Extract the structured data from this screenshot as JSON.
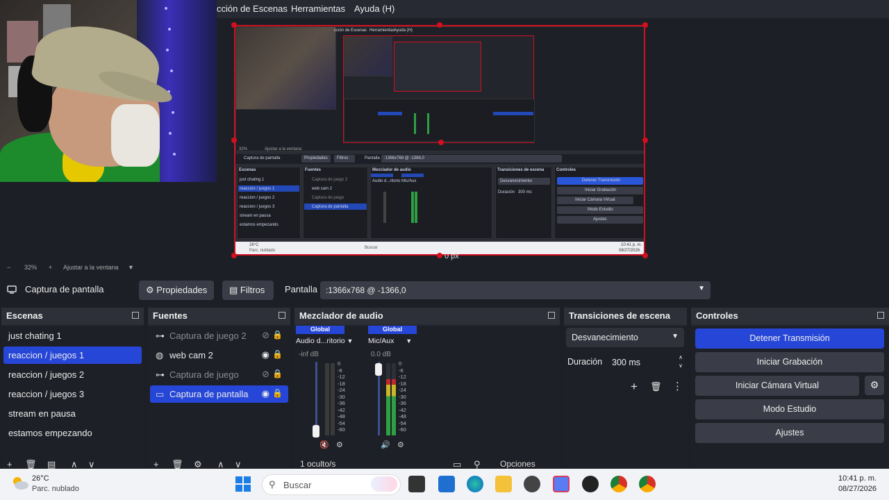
{
  "menubar": {
    "items": [
      "cción de Escenas",
      "Herramientas",
      "Ayuda (H)"
    ]
  },
  "preview": {
    "size_label": "0 px",
    "nested_menu": [
      "cción de Escenas",
      "Herramientas",
      "Ayuda (H)"
    ],
    "nested_source_bar": {
      "source": "Captura de pantalla",
      "props": "Propiedades",
      "filters": "Filtros",
      "display_label": "Pantalla",
      "display_value": ":1366x768 @ -1366,0"
    },
    "nested_zoom": "32%",
    "nested_fit": "Ajustar a la ventana",
    "nested_scenes": [
      "just chating 1",
      "reaccion / juegos 1",
      "reaccion / juegos 2",
      "reaccion / juegos 3",
      "stream en pausa",
      "estamos empezando"
    ],
    "nested_sources": [
      "Captura de juego 2",
      "web cam 2",
      "Captura de juego",
      "Captura de pantalla"
    ],
    "nested_controls": [
      "Detener Transmisión",
      "Iniciar Grabación",
      "Iniciar Cámara Virtual",
      "Modo Estudio",
      "Ajustes"
    ],
    "nested_transition": "Desvanecimiento",
    "nested_duration_label": "Duración",
    "nested_duration": "300 ms",
    "nested_docks": [
      "Escenas",
      "Fuentes",
      "Mezclador de audio",
      "Transiciones de escena",
      "Controles"
    ],
    "nested_mixer_channels": [
      "Global",
      "Global"
    ],
    "nested_mixer_devices": [
      "Audio d...ritorio",
      "Mic/Aux"
    ],
    "nested_taskbar_temp": "26°C",
    "nested_taskbar_desc": "Parc. nublado",
    "nested_taskbar_search": "Buscar",
    "nested_clock_time": "10:41 p. m.",
    "nested_clock_date": "08/27/2026"
  },
  "zoom_bar": {
    "minus": "−",
    "zoom": "32%",
    "plus": "+",
    "fit": "Ajustar a la ventana"
  },
  "source_toolbar": {
    "source_name": "Captura de pantalla",
    "properties": "Propiedades",
    "filters": "Filtros",
    "display_label": "Pantalla",
    "display_value": ":1366x768 @ -1366,0"
  },
  "scenes": {
    "title": "Escenas",
    "items": [
      "just chating 1",
      "reaccion / juegos 1",
      "reaccion / juegos 2",
      "reaccion / juegos 3",
      "stream en pausa",
      "estamos empezando"
    ],
    "selected_index": 1
  },
  "sources": {
    "title": "Fuentes",
    "items": [
      {
        "label": "Captura de juego 2",
        "icon": "gamepad-icon",
        "visible": false
      },
      {
        "label": "web cam 2",
        "icon": "globe-icon",
        "visible": true
      },
      {
        "label": "Captura de juego",
        "icon": "gamepad-icon",
        "visible": false
      },
      {
        "label": "Captura de pantalla",
        "icon": "monitor-icon",
        "visible": true
      }
    ],
    "selected_index": 3
  },
  "mixer": {
    "title": "Mezclador de audio",
    "channels": [
      {
        "head": "Global",
        "device": "Audio d...ritorio",
        "db": "-inf dB",
        "level": 0.0
      },
      {
        "head": "Global",
        "device": "Mic/Aux",
        "db": "0.0 dB",
        "level": 0.78
      }
    ],
    "scale": [
      "0",
      "-6",
      "-12",
      "-18",
      "-24",
      "-30",
      "-36",
      "-42",
      "-48",
      "-54",
      "-60"
    ],
    "footer_hidden": "1 oculto/s",
    "footer_options": "Opciones"
  },
  "transitions": {
    "title": "Transiciones de escena",
    "selected": "Desvanecimiento",
    "duration_label": "Duración",
    "duration_value": "300 ms"
  },
  "controls": {
    "title": "Controles",
    "stop_stream": "Detener Transmisión",
    "start_recording": "Iniciar Grabación",
    "start_virtual_cam": "Iniciar Cámara Virtual",
    "studio_mode": "Modo Estudio",
    "settings": "Ajustes"
  },
  "taskbar": {
    "temp": "26°C",
    "weather": "Parc. nublado",
    "search": "Buscar",
    "time": "10:41 p. m.",
    "date": "08/27/2026"
  },
  "colors": {
    "accent": "#2646d8",
    "selection_border": "#d30f1f",
    "meter_green": "#2ea043",
    "meter_yellow": "#c9b72a",
    "meter_red": "#c0282b"
  }
}
